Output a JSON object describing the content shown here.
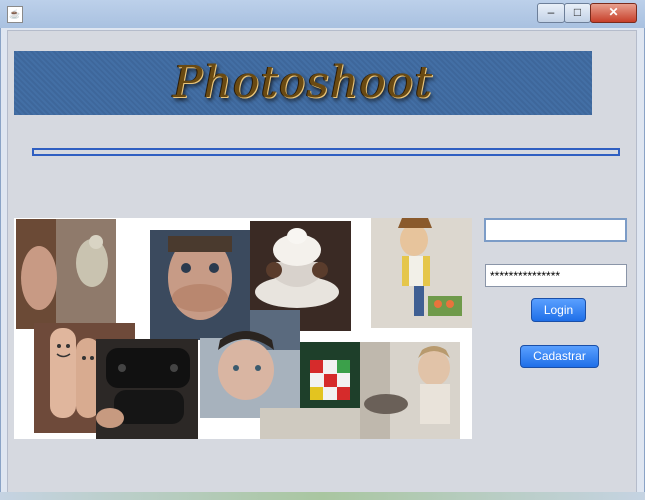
{
  "window": {
    "app_icon": "java-cup-icon",
    "minimize": "–",
    "maximize": "□",
    "close": "✕"
  },
  "banner": {
    "title": "Photoshoot"
  },
  "progress": {
    "value": 0
  },
  "login_form": {
    "username_value": "",
    "password_value": "***************",
    "login_label": "Login",
    "register_label": "Cadastrar"
  },
  "collage": {
    "photos": [
      "girl-with-parrot",
      "man-covering-mouth",
      "ice-cream-sundae",
      "woody-toy-with-sushi",
      "smiley-face-fingers",
      "game-controller",
      "man-portrait",
      "rubiks-cube",
      "child-with-cat"
    ]
  },
  "colors": {
    "button": "#1f6fe8",
    "banner": "#3e679b",
    "progress_border": "#2f5fc2"
  }
}
